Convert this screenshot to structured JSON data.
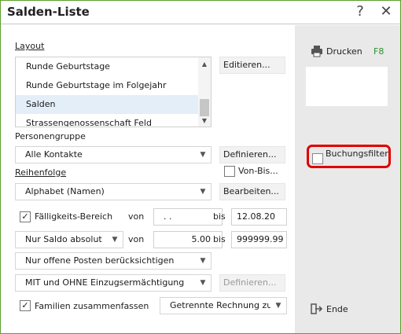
{
  "window": {
    "title": "Salden-Liste",
    "help_icon": "question-mark-icon",
    "close_icon": "close-icon"
  },
  "layout": {
    "label": "Layout",
    "items": [
      "Runde Geburtstage",
      "Runde Geburtstage im Folgejahr",
      "Salden",
      "Strassengenossenschaft Feld"
    ],
    "selected": "Salden",
    "edit_button": "Editieren..."
  },
  "personengruppe": {
    "label": "Personengruppe",
    "value": "Alle Kontakte",
    "define_button": "Definieren...",
    "von_bis_label": "Von-Bis..."
  },
  "reihenfolge": {
    "label": "Reihenfolge",
    "value": "Alphabet (Namen)",
    "edit_button": "Bearbeiten..."
  },
  "faelligkeit": {
    "checkbox_label": "Fälligkeits-Bereich",
    "checked": true,
    "from_label": "von",
    "from_value": ". .",
    "to_label": "bis",
    "to_value": "12.08.20"
  },
  "saldo": {
    "value": "Nur Saldo absolut",
    "from_label": "von",
    "from_value": "5.00",
    "to_label": "bis",
    "to_value": "999999.99"
  },
  "offene_posten": {
    "value": "Nur offene Posten berücksichtigen"
  },
  "einzug": {
    "value": "MIT und OHNE Einzugsermächtigung",
    "define_button": "Definieren..."
  },
  "familien": {
    "checkbox_label": "Familien zusammenfassen",
    "checked": true,
    "rechnung_value": "Getrennte Rechnung zusa"
  },
  "sidebar": {
    "print_label": "Drucken",
    "print_shortcut": "F8",
    "print_icon": "printer-icon",
    "buchungsfilter_label": "Buchungsfilter",
    "end_label": "Ende",
    "end_icon": "exit-icon"
  },
  "colors": {
    "border": "#5aa02c",
    "shortcut": "#2f8f2f",
    "highlight": "#e00000"
  }
}
